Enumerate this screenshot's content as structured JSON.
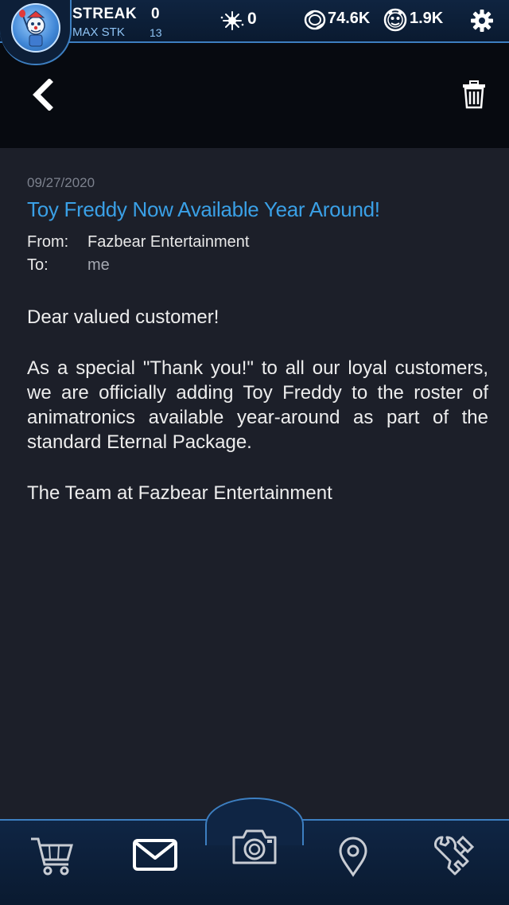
{
  "status_bar": {
    "streak_label": "STREAK",
    "streak_value": "0",
    "max_streak_label": "MAX STK",
    "max_streak_value": "13",
    "remnant_value": "0",
    "faz_coins": "74.6K",
    "faz_tokens": "1.9K"
  },
  "message": {
    "date": "09/27/2020",
    "subject": "Toy Freddy Now Available Year Around!",
    "from_label": "From:",
    "from_value": "Fazbear Entertainment",
    "to_label": "To:",
    "to_value": "me",
    "body": [
      "Dear valued customer!",
      "As a special \"Thank you!\" to all our loyal customers, we are officially adding Toy Freddy to the roster of animatronics available year-around as part of the standard Eternal Package.",
      "The Team at Fazbear Entertainment"
    ]
  },
  "icons": {
    "back": "chevron-left-icon",
    "delete": "trash-icon",
    "settings": "gear-icon",
    "nav": [
      "cart-icon",
      "mail-icon",
      "camera-icon",
      "map-pin-icon",
      "wrench-icon"
    ]
  },
  "colors": {
    "accent_blue": "#3aa0e6",
    "bar_border": "#3d7fc1",
    "content_bg": "#1c1f29",
    "header_bg": "#070a10"
  }
}
